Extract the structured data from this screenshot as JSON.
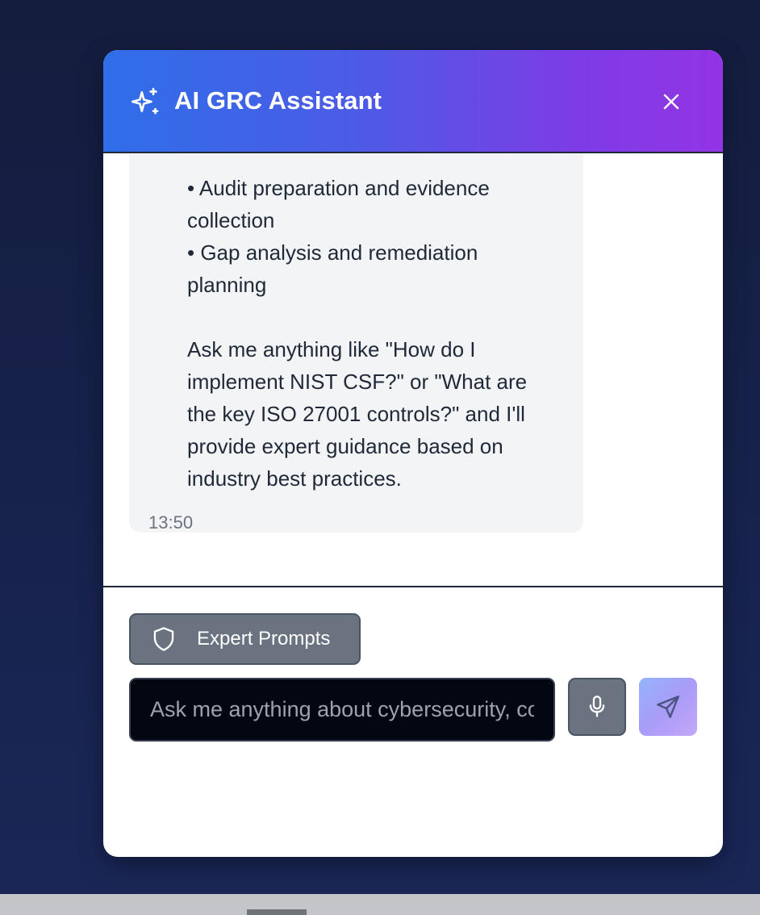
{
  "header": {
    "title": "AI GRC Assistant",
    "icon": "sparkles-icon",
    "close_icon": "close-icon"
  },
  "message": {
    "lines": [
      "• Audit preparation and evidence",
      "collection",
      "• Gap analysis and remediation",
      "planning",
      "Ask me anything like \"How do I",
      "implement NIST CSF?\" or \"What are",
      "the key ISO 27001 controls?\" and I'll",
      "provide expert guidance based on",
      "industry best practices."
    ],
    "time": "13:50"
  },
  "composer": {
    "expert_prompts_label": "Expert Prompts",
    "expert_prompts_icon": "shield-icon",
    "input_placeholder": "Ask me anything about cybersecurity, compliance, or risk management...",
    "input_value": "",
    "mic_icon": "microphone-icon",
    "send_icon": "send-icon"
  },
  "colors": {
    "header_gradient_start": "#2f6ee8",
    "header_gradient_end": "#9334e6",
    "bubble_background": "#f3f4f6",
    "input_background": "#030712",
    "button_gray": "#6b7280"
  }
}
